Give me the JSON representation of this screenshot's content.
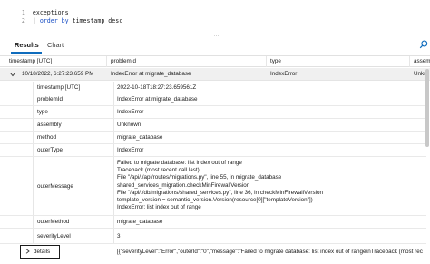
{
  "editor": {
    "lines": [
      {
        "num": "1",
        "text": "exceptions"
      },
      {
        "num": "2",
        "pipe": "|",
        "kw": "order by",
        "rest": " timestamp desc"
      }
    ]
  },
  "grip_glyph": "...",
  "tabs": [
    {
      "label": "Results",
      "active": true
    },
    {
      "label": "Chart",
      "active": false
    }
  ],
  "search_icon": "search-icon",
  "columns": [
    "timestamp [UTC]",
    "problemId",
    "type",
    "assem"
  ],
  "main_row": {
    "timestamp": "10/18/2022, 6:27:23.659 PM",
    "problemId": "IndexError at migrate_database",
    "type": "IndexError",
    "assembly": "Unkn"
  },
  "details": [
    {
      "key": "timestamp [UTC]",
      "value": "2022-10-18T18:27:23.659561Z"
    },
    {
      "key": "problemId",
      "value": "IndexError at migrate_database"
    },
    {
      "key": "type",
      "value": "IndexError"
    },
    {
      "key": "assembly",
      "value": "Unknown"
    },
    {
      "key": "method",
      "value": "migrate_database"
    },
    {
      "key": "outerType",
      "value": "IndexError"
    },
    {
      "key": "outerMessage",
      "lines": [
        "Failed to migrate database: list index out of range",
        "Traceback (most recent call last):",
        "File \"/api/./api/routes/migrations.py\", line 55, in migrate_database",
        "shared_services_migration.checkMinFirewallVersion",
        "File \"/api/./db/migrations/shared_services.py\", line 36, in checkMinFirewallVersion",
        "template_version = semantic_version.Version(resource[0][\"templateVersion\"])",
        "IndexError: list index out of range"
      ]
    },
    {
      "key": "outerMethod",
      "value": "migrate_database"
    },
    {
      "key": "severityLevel",
      "value": "3"
    }
  ],
  "details_row": {
    "key": "details",
    "value": "[{\"severityLevel\":\"Error\",\"outerId\":\"0\",\"message\":\"Failed to migrate database: list index out of range\\nTraceback (most rec"
  }
}
